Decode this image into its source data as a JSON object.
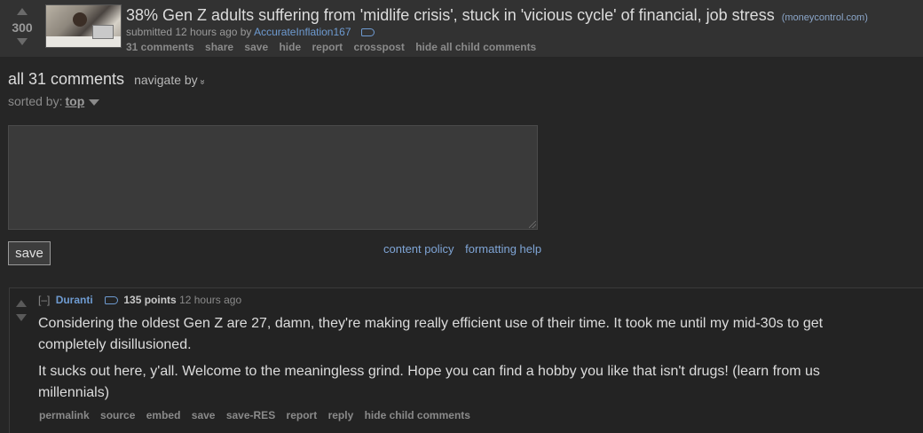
{
  "post": {
    "score": "300",
    "title": "38% Gen Z adults suffering from 'midlife crisis', stuck in 'vicious cycle' of financial, job stress",
    "domain": "(moneycontrol.com)",
    "submitted_prefix": "submitted 12 hours ago by",
    "author": "AccurateInflation167",
    "buttons": [
      "31 comments",
      "share",
      "save",
      "hide",
      "report",
      "crosspost",
      "hide all child comments"
    ]
  },
  "comments_header": {
    "title": "all 31 comments",
    "navigate": "navigate by",
    "navigate_icon": "»",
    "sorted_label": "sorted by:",
    "sort_value": "top"
  },
  "reply_form": {
    "textarea_value": "",
    "save_label": "save",
    "content_policy": "content policy",
    "formatting_help": "formatting help"
  },
  "comment": {
    "collapse": "[–]",
    "author": "Duranti",
    "points": "135 points",
    "time": "12 hours ago",
    "paragraphs": [
      "Considering the oldest Gen Z are 27, damn, they're making really efficient use of their time. It took me until my mid-30s to get completely disillusioned.",
      "It sucks out here, y'all. Welcome to the meaningless grind. Hope you can find a hobby you like that isn't drugs! (learn from us millennials)"
    ],
    "buttons": [
      "permalink",
      "source",
      "embed",
      "save",
      "save-RES",
      "report",
      "reply",
      "hide child comments"
    ]
  }
}
